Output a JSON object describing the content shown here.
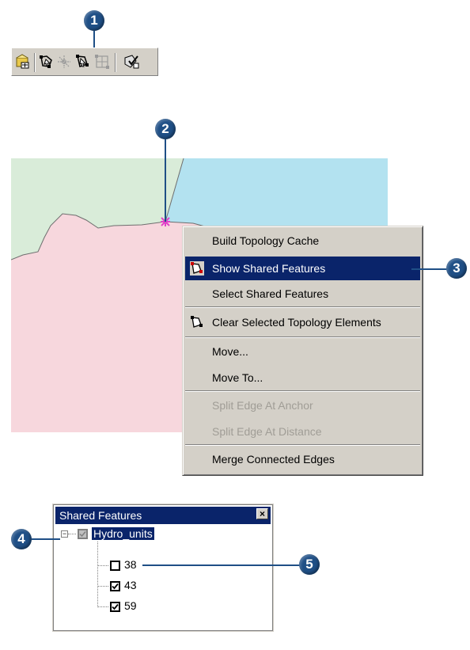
{
  "callouts": {
    "c1": "1",
    "c2": "2",
    "c3": "3",
    "c4": "4",
    "c5": "5"
  },
  "toolbar": {
    "buttons": [
      {
        "icon": "topology-build-icon"
      },
      {
        "icon": "topology-edit-icon"
      },
      {
        "icon": "topology-edge-icon"
      },
      {
        "icon": "show-shared-features-icon"
      },
      {
        "icon": "topology-element-icon"
      },
      {
        "icon": "validate-topology-icon"
      }
    ]
  },
  "map": {
    "colors": {
      "green": "#d9ecd9",
      "blue": "#b3e2f0",
      "pink": "#f7d7dd",
      "vertex": "#e040c8"
    }
  },
  "context_menu": {
    "items": [
      {
        "label": "Build Topology Cache"
      },
      {
        "label": "Show Shared Features",
        "selected": true
      },
      {
        "label": "Select Shared Features"
      },
      {
        "label": "Clear Selected Topology Elements"
      },
      {
        "label": "Move..."
      },
      {
        "label": "Move To..."
      },
      {
        "label": "Split Edge At Anchor",
        "disabled": true
      },
      {
        "label": "Split Edge At Distance",
        "disabled": true
      },
      {
        "label": "Merge Connected Edges"
      }
    ]
  },
  "shared_features": {
    "title": "Shared Features",
    "layer": "Hydro_units",
    "items": [
      {
        "label": "38",
        "checked": false
      },
      {
        "label": "43",
        "checked": true
      },
      {
        "label": "59",
        "checked": true
      }
    ]
  }
}
